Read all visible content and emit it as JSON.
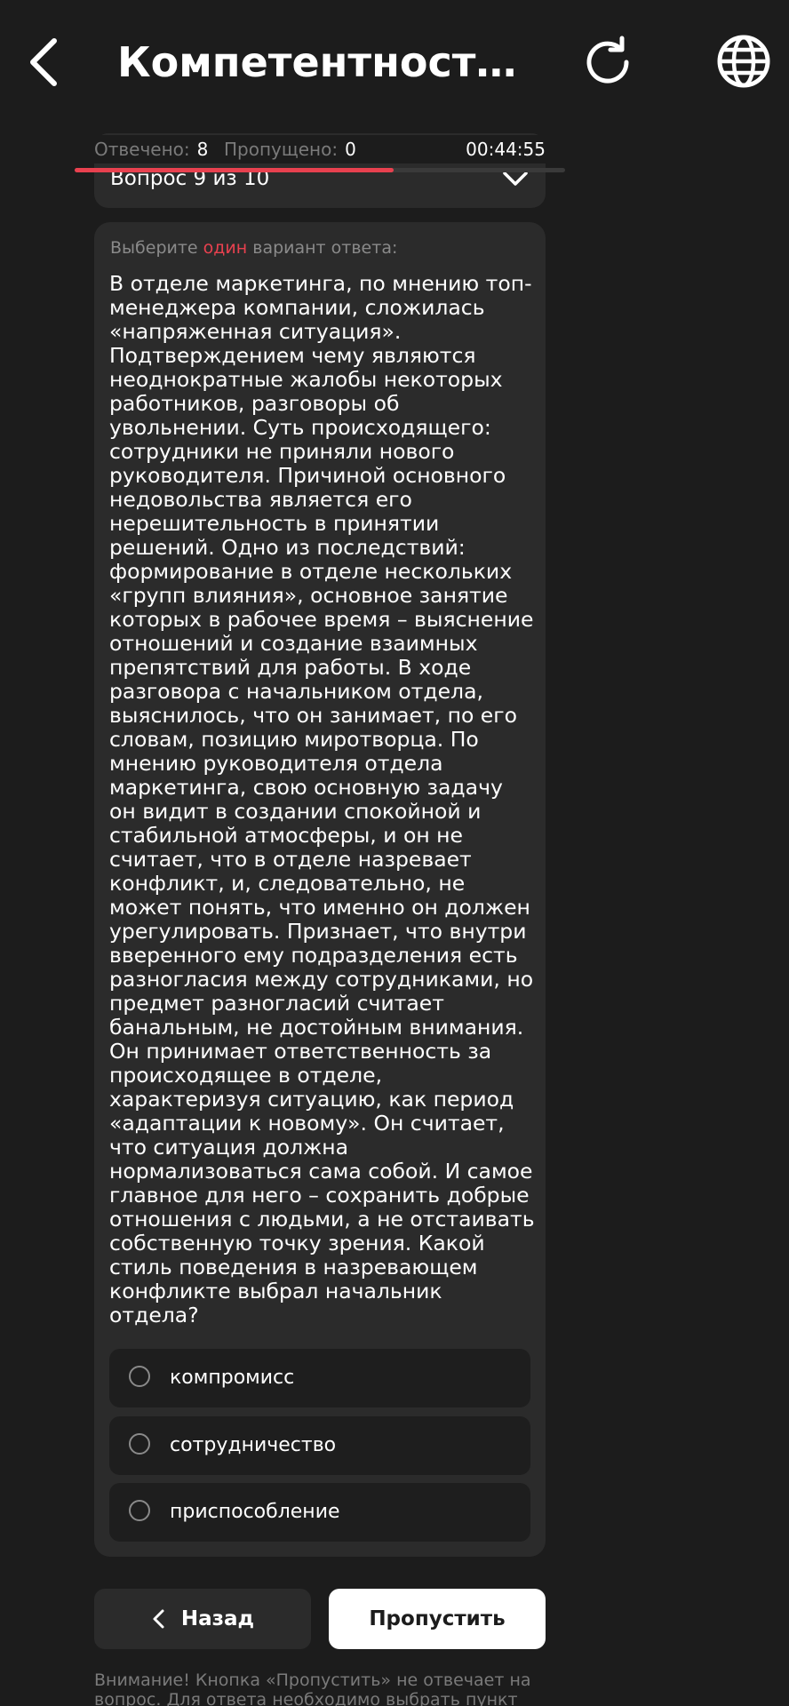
{
  "header": {
    "title": "Компетентностны...",
    "back_icon": "chevron-left-icon",
    "refresh_icon": "refresh-icon",
    "language_icon": "globe-icon"
  },
  "progress": {
    "answered_label": "Отвечено:",
    "answered_value": "8",
    "skipped_label": "Пропущено:",
    "skipped_value": "0",
    "timer": "00:44:55",
    "fill_fraction": 0.65,
    "fill_color": "#e8414f"
  },
  "question_selector": {
    "label": "Вопрос 9 из 10",
    "icon": "chevron-down-icon"
  },
  "card": {
    "instruction_prefix": "Выберите ",
    "instruction_accent": "один",
    "instruction_suffix": " вариант ответа:",
    "question": "В отделе маркетинга, по мнению топ-менеджера компании, сложилась «напряженная ситуация». Подтверждением чему являются неоднократные жалобы некоторых работников, разговоры об увольнении. Суть происходящего: сотрудники не приняли нового руководителя. Причиной основного недовольства является его нерешительность в принятии решений. Одно из последствий: формирование в отделе нескольких «групп влияния», основное занятие которых в рабочее время – выяснение отношений и создание взаимных препятствий для работы. В ходе разговора с начальником отдела, выяснилось, что он занимает, по его словам, позицию миротворца. По мнению руководителя отдела маркетинга, свою основную задачу он видит в создании спокойной и стабильной атмосферы, и он не считает, что в отделе назревает конфликт, и, следовательно, не может понять, что именно он должен урегулировать. Признает, что внутри вверенного ему подразделения есть разногласия между сотрудниками, но предмет разногласий считает банальным, не достойным внимания. Он принимает ответственность за происходящее в отделе, характеризуя ситуацию, как период «адаптации к новому». Он считает, что ситуация должна нормализоваться сама собой. И самое главное для него – сохранить добрые отношения с людьми, а не отстаивать собственную точку зрения. Какой стиль поведения в назревающем конфликте выбрал начальник отдела?",
    "options": [
      {
        "label": "компромисс"
      },
      {
        "label": "сотрудничество"
      },
      {
        "label": "приспособление"
      }
    ]
  },
  "actions": {
    "back_label": "Назад",
    "skip_label": "Пропустить"
  },
  "notice": "Внимание! Кнопка «Пропустить» не отвечает на вопрос. Для ответа необходимо выбрать пункт"
}
